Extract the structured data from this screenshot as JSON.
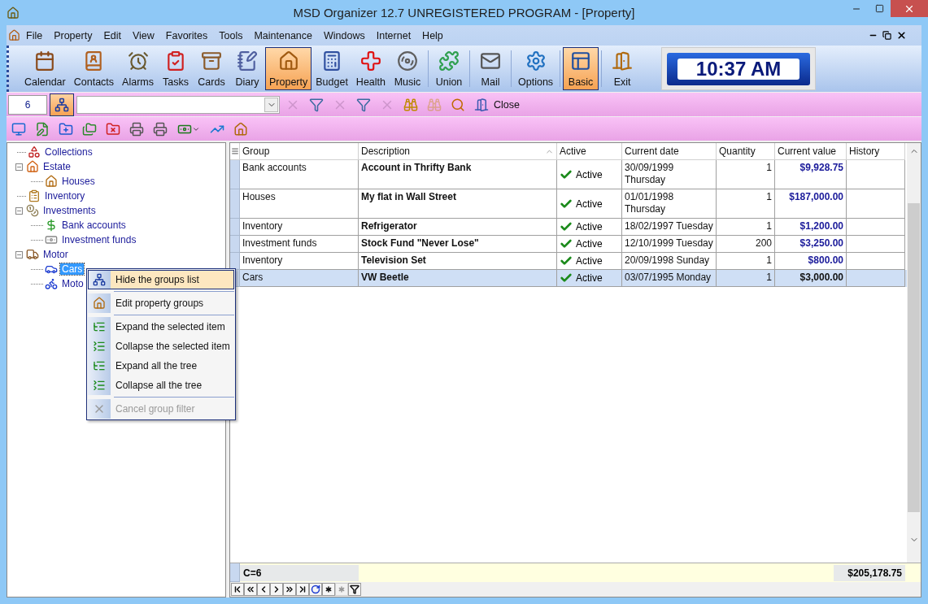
{
  "window": {
    "title": "MSD Organizer 12.7 UNREGISTERED PROGRAM - [Property]"
  },
  "menu_bar": [
    "File",
    "Property",
    "Edit",
    "View",
    "Favorites",
    "Tools",
    "Maintenance",
    "Windows",
    "Internet",
    "Help"
  ],
  "main_toolbar": [
    {
      "kind": "calendar",
      "label": "Calendar",
      "selected": false
    },
    {
      "kind": "contacts",
      "label": "Contacts",
      "selected": false
    },
    {
      "kind": "alarms",
      "label": "Alarms",
      "selected": false
    },
    {
      "kind": "tasks",
      "label": "Tasks",
      "selected": false
    },
    {
      "kind": "cards",
      "label": "Cards",
      "selected": false
    },
    {
      "kind": "diary",
      "label": "Diary",
      "selected": false
    },
    {
      "kind": "property",
      "label": "Property",
      "selected": true
    },
    {
      "kind": "budget",
      "label": "Budget",
      "selected": false
    },
    {
      "kind": "health",
      "label": "Health",
      "selected": false
    },
    {
      "kind": "music",
      "label": "Music",
      "selected": false
    },
    {
      "kind": "union",
      "label": "Union",
      "selected": false
    },
    {
      "kind": "mail",
      "label": "Mail",
      "selected": false
    },
    {
      "kind": "options",
      "label": "Options",
      "selected": false
    },
    {
      "kind": "basic",
      "label": "Basic",
      "selected": true
    },
    {
      "kind": "exit",
      "label": "Exit",
      "selected": false
    }
  ],
  "clock": "10:37 AM",
  "filter_bar": {
    "record_count": "6",
    "groups_toggle": {
      "selected": true
    },
    "tools": [
      {
        "kind": "delete",
        "disabled": true
      },
      {
        "kind": "filter",
        "disabled": false
      },
      {
        "kind": "delete",
        "disabled": true
      },
      {
        "kind": "filter",
        "disabled": false
      },
      {
        "kind": "delete",
        "disabled": true
      },
      {
        "kind": "find",
        "disabled": false
      },
      {
        "kind": "find",
        "disabled": true
      },
      {
        "kind": "search",
        "disabled": false
      }
    ],
    "close_label": "Close"
  },
  "record_bar": [
    {
      "kind": "monitor"
    },
    {
      "kind": "edit"
    },
    {
      "kind": "add"
    },
    {
      "kind": "copy"
    },
    {
      "kind": "remove"
    },
    {
      "kind": "print"
    },
    {
      "kind": "print"
    },
    {
      "kind": "money"
    },
    {
      "kind": "chart"
    },
    {
      "kind": "house"
    }
  ],
  "groups_tree": [
    {
      "kind": "collections",
      "label": "Collections",
      "selected": false
    },
    {
      "kind": "estate",
      "label": "Estate",
      "selected": false,
      "expanded": true,
      "children": [
        {
          "kind": "house",
          "label": "Houses",
          "selected": false
        }
      ]
    },
    {
      "kind": "inventory",
      "label": "Inventory",
      "selected": false
    },
    {
      "kind": "investments",
      "label": "Investments",
      "selected": false,
      "expanded": true,
      "children": [
        {
          "kind": "bank",
          "label": "Bank accounts",
          "selected": false
        },
        {
          "kind": "funds",
          "label": "Investment funds",
          "selected": false
        }
      ]
    },
    {
      "kind": "motor",
      "label": "Motor",
      "selected": false,
      "expanded": true,
      "children": [
        {
          "kind": "car",
          "label": "Cars",
          "selected": true
        },
        {
          "kind": "bike",
          "label": "Moto",
          "selected": false
        }
      ]
    }
  ],
  "context_menu": [
    {
      "kind": "item",
      "label": "Hide the groups list",
      "selected": true,
      "disabled": false
    },
    {
      "kind": "separator"
    },
    {
      "kind": "item",
      "label": "Edit property groups",
      "selected": false,
      "disabled": false
    },
    {
      "kind": "separator"
    },
    {
      "kind": "item",
      "label": "Expand the selected item",
      "selected": false,
      "disabled": false
    },
    {
      "kind": "item",
      "label": "Collapse the selected item",
      "selected": false,
      "disabled": false
    },
    {
      "kind": "item",
      "label": "Expand all the tree",
      "selected": false,
      "disabled": false
    },
    {
      "kind": "item",
      "label": "Collapse all the tree",
      "selected": false,
      "disabled": false
    },
    {
      "kind": "separator"
    },
    {
      "kind": "item",
      "label": "Cancel group filter",
      "selected": false,
      "disabled": true
    }
  ],
  "table": {
    "columns": [
      "Group",
      "Description",
      "Active",
      "Current date",
      "Quantity",
      "Current value",
      "History"
    ],
    "rows": [
      {
        "group": "Bank accounts",
        "description": "Account in Thrifty Bank",
        "active": true,
        "active_label": "Active",
        "date": "30/09/1999 Thursday",
        "quantity": "1",
        "value": "$9,928.75",
        "selected": false
      },
      {
        "group": "Houses",
        "description": "My flat in Wall Street",
        "active": true,
        "active_label": "Active",
        "date": "01/01/1998 Thursday",
        "quantity": "1",
        "value": "$187,000.00",
        "selected": false
      },
      {
        "group": "Inventory",
        "description": "Refrigerator",
        "active": true,
        "active_label": "Active",
        "date": "18/02/1997 Tuesday",
        "quantity": "1",
        "value": "$1,200.00",
        "selected": false
      },
      {
        "group": "Investment funds",
        "description": "Stock Fund \"Never Lose\"",
        "active": true,
        "active_label": "Active",
        "date": "12/10/1999 Tuesday",
        "quantity": "200",
        "value": "$3,250.00",
        "selected": false
      },
      {
        "group": "Inventory",
        "description": "Television Set",
        "active": true,
        "active_label": "Active",
        "date": "20/09/1998 Sunday",
        "quantity": "1",
        "value": "$800.00",
        "selected": false
      },
      {
        "group": "Cars",
        "description": "VW Beetle",
        "active": true,
        "active_label": "Active",
        "date": "03/07/1995 Monday",
        "quantity": "1",
        "value": "$3,000.00",
        "selected": true
      }
    ],
    "footer": {
      "count": "C=6",
      "total": "$205,178.75"
    }
  },
  "navigator": [
    {
      "kind": "first",
      "disabled": false
    },
    {
      "kind": "prev_page",
      "disabled": false
    },
    {
      "kind": "prev",
      "disabled": false
    },
    {
      "kind": "next",
      "disabled": false
    },
    {
      "kind": "next_page",
      "disabled": false
    },
    {
      "kind": "last",
      "disabled": false
    },
    {
      "kind": "refresh",
      "disabled": false
    },
    {
      "kind": "insert",
      "disabled": false
    },
    {
      "kind": "insert",
      "disabled": true
    },
    {
      "kind": "filter",
      "disabled": false
    }
  ]
}
